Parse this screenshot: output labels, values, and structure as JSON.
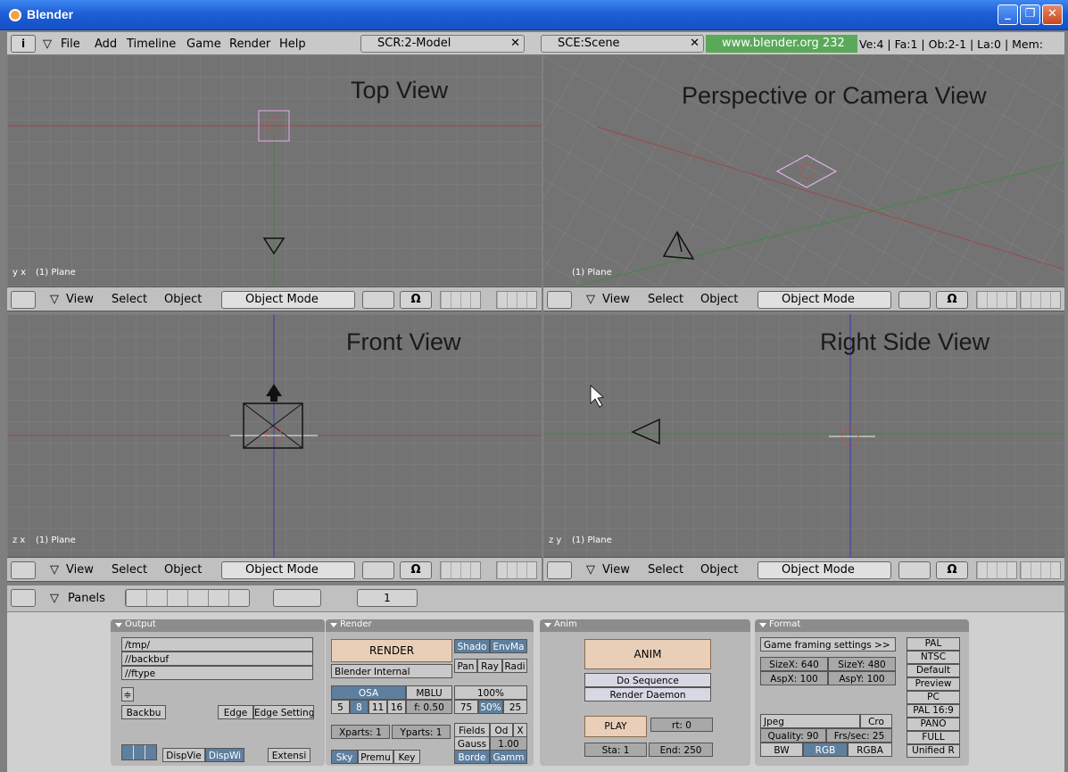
{
  "window": {
    "title": "Blender"
  },
  "menubar": {
    "items": [
      "File",
      "Add",
      "Timeline",
      "Game",
      "Render",
      "Help"
    ],
    "screen": "SCR:2-Model",
    "scene": "SCE:Scene",
    "site": "www.blender.org 232",
    "stats": "Ve:4 | Fa:1 | Ob:2-1 | La:0 | Mem:"
  },
  "viewports": [
    {
      "label": "Top View",
      "sub": "(1) Plane",
      "axis": "y x"
    },
    {
      "label": "Perspective or Camera View",
      "sub": "(1) Plane",
      "axis": ""
    },
    {
      "label": "Front View",
      "sub": "(1) Plane",
      "axis": "z x"
    },
    {
      "label": "Right Side View",
      "sub": "(1) Plane",
      "axis": "z y"
    }
  ],
  "vheader": {
    "view": "View",
    "select": "Select",
    "object": "Object",
    "mode": "Object Mode"
  },
  "panelsbar": {
    "label": "Panels",
    "frame": "1"
  },
  "output": {
    "title": "Output",
    "paths": [
      "/tmp/",
      "//backbuf",
      "//ftype"
    ],
    "backbuf": "Backbu",
    "edge": "Edge",
    "edge_settings": "Edge Setting",
    "dispview": "DispVie",
    "dispwin": "DispWi",
    "extensions": "Extensi"
  },
  "render": {
    "title": "Render",
    "render": "RENDER",
    "shadow": "Shado",
    "envmap": "EnvMa",
    "pano": "Pan",
    "ray": "Ray",
    "radio": "Radi",
    "engine": "Blender Internal",
    "osa": "OSA",
    "mblur": "MBLU",
    "pct100": "100%",
    "osa_values": [
      "5",
      "8",
      "11",
      "16"
    ],
    "f": "f: 0.50",
    "pct_values": [
      "75",
      "50%",
      "25"
    ],
    "xparts": "Xparts: 1",
    "yparts": "Yparts: 1",
    "fields": "Fields",
    "odd": "Od",
    "x": "X",
    "gauss": "Gauss",
    "gauss_val": "1.00",
    "sky": "Sky",
    "premul": "Premu",
    "key": "Key",
    "border": "Borde",
    "gamma": "Gamm"
  },
  "anim": {
    "title": "Anim",
    "anim": "ANIM",
    "do_sequence": "Do Sequence",
    "render_daemon": "Render Daemon",
    "play": "PLAY",
    "rt": "rt: 0",
    "sta": "Sta: 1",
    "end": "End: 250"
  },
  "format": {
    "title": "Format",
    "game": "Game framing settings >>",
    "sizex": "SizeX: 640",
    "sizey": "SizeY: 480",
    "aspx": "AspX: 100",
    "aspy": "AspY: 100",
    "presets": [
      "PAL",
      "NTSC",
      "Default",
      "Preview",
      "PC",
      "PAL 16:9",
      "PANO",
      "FULL",
      "Unified R"
    ],
    "codec": "Jpeg",
    "crop": "Cro",
    "quality": "Quality: 90",
    "fps": "Frs/sec: 25",
    "bw": "BW",
    "rgb": "RGB",
    "rgba": "RGBA"
  }
}
